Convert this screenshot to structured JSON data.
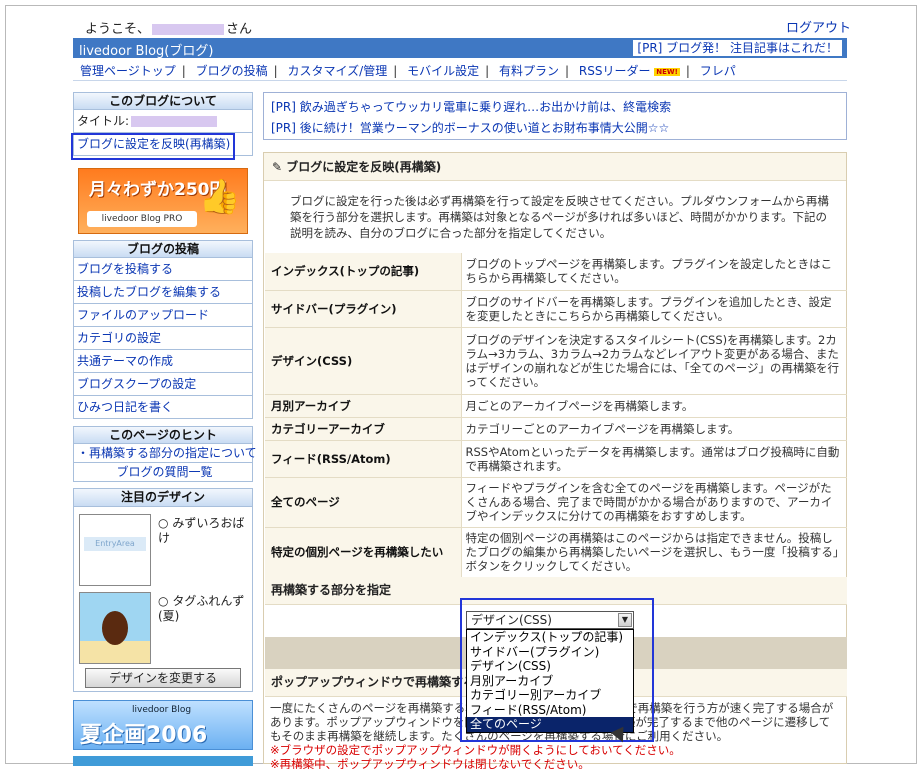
{
  "header": {
    "welcome_prefix": "ようこそ、",
    "welcome_suffix": "さん",
    "logout": "ログアウト",
    "brand": "livedoor Blog(ブログ)",
    "pr": "[PR] ブログ発！ 注目記事はこれだ！"
  },
  "nav": {
    "items": [
      "管理ページトップ",
      "ブログの投稿",
      "カスタマイズ/管理",
      "モバイル設定",
      "有料プラン",
      "RSSリーダー",
      "フレパ"
    ],
    "new_badge": "NEW!"
  },
  "sidebar": {
    "about": {
      "title": "このブログについて",
      "title_label": "タイトル:",
      "link": "ブログに設定を反映(再構築)"
    },
    "promo": {
      "text": "月々わずか250円",
      "sub": "livedoor Blog PRO"
    },
    "posts": {
      "title": "ブログの投稿",
      "items": [
        "ブログを投稿する",
        "投稿したブログを編集する",
        "ファイルのアップロード",
        "カテゴリの設定",
        "共通テーマの作成",
        "ブログスクープの設定",
        "ひみつ日記を書く"
      ]
    },
    "hint": {
      "title": "このページのヒント",
      "items": [
        "・再構築する部分の指定について",
        "ブログの質問一覧"
      ]
    },
    "design": {
      "title": "注目のデザイン",
      "d1": "みずいろおばけ",
      "d1_thumb": "EntryArea",
      "d2": "タグふれんず(夏)",
      "button": "デザインを変更する"
    },
    "summer": {
      "brand": "livedoor Blog",
      "text": "夏企画2006"
    }
  },
  "pr_box": {
    "l1": "[PR] 飲み過ぎちゃってウッカリ電車に乗り遅れ…お出かけ前は、終電検索",
    "l2": "[PR] 後に続け！営業ウーマン的ボーナスの使い道とお財布事情大公開☆☆"
  },
  "panel": {
    "title": "ブログに設定を反映(再構築)",
    "desc": "ブログに設定を行った後は必ず再構築を行って設定を反映させてください。プルダウンフォームから再構築を行う部分を選択します。再構築は対象となるページが多ければ多いほど、時間がかかります。下記の説明を読み、自分のブログに合った部分を指定してください。",
    "rows": [
      {
        "k": "インデックス(トップの記事)",
        "v": "ブログのトップページを再構築します。プラグインを設定したときはこちらから再構築してください。"
      },
      {
        "k": "サイドバー(プラグイン)",
        "v": "ブログのサイドバーを再構築します。プラグインを追加したとき、設定を変更したときにこちらから再構築してください。"
      },
      {
        "k": "デザイン(CSS)",
        "v": "ブログのデザインを決定するスタイルシート(CSS)を再構築します。2カラム→3カラム、3カラム→2カラムなどレイアウト変更がある場合、またはデザインの崩れなどが生じた場合には、「全てのページ」の再構築を行ってください。"
      },
      {
        "k": "月別アーカイブ",
        "v": "月ごとのアーカイブページを再構築します。"
      },
      {
        "k": "カテゴリーアーカイブ",
        "v": "カテゴリーごとのアーカイブページを再構築します。"
      },
      {
        "k": "フィード(RSS/Atom)",
        "v": "RSSやAtomといったデータを再構築します。通常はブログ投稿時に自動で再構築されます。"
      },
      {
        "k": "全てのページ",
        "v": "フィードやプラグインを含む全てのページを再構築します。ページがたくさんある場合、完了まで時間がかかる場合がありますので、アーカイブやインデックスに分けての再構築をおすすめします。"
      },
      {
        "k": "特定の個別ページを再構築したい",
        "v": "特定の個別ページの再構築はこのページからは指定できません。投稿したブログの編集から再構築したいページを選択し、もう一度「投稿する」ボタンをクリックしてください。"
      }
    ],
    "select_label": "再構築する部分を指定",
    "popup_label": "ポップアップウィンドウで再構築する",
    "popup_desc": "一度にたくさんのページを再構築する場合、ポップアップウィンドウで再構築を行う方が速く完了する場合があります。ポップアップウィンドウを閉じたままにしておくと、再構築が完了するまで他のページに遷移してもそのまま再構築を継続します。たくさんのページを再構築する場合にご利用ください。",
    "note1": "※ブラウザの設定でポップアップウィンドウが開くようにしておいてください。",
    "note2": "※再構築中、ポップアップウィンドウは閉じないでください。"
  },
  "dropdown": {
    "selected": "デザイン(CSS)",
    "options": [
      "インデックス(トップの記事)",
      "サイドバー(プラグイン)",
      "デザイン(CSS)",
      "月別アーカイブ",
      "カテゴリー別アーカイブ",
      "フィード(RSS/Atom)",
      "全てのページ"
    ],
    "highlighted_index": 6
  }
}
